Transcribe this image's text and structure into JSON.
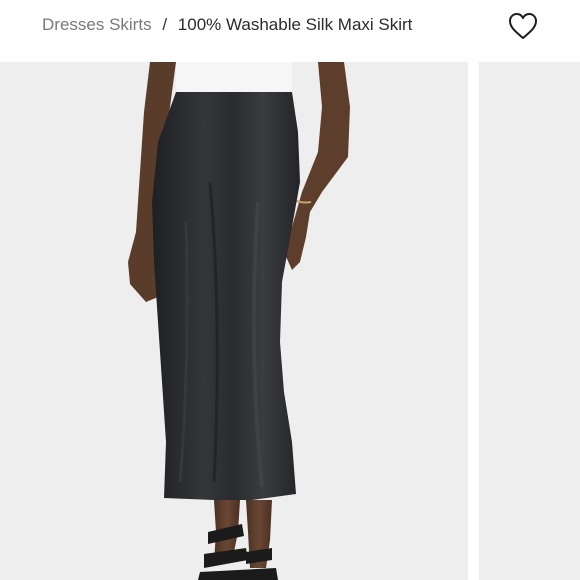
{
  "breadcrumb": {
    "items": [
      {
        "label": "Dresses Skirts",
        "link": true
      }
    ],
    "separator": "/",
    "current": "100% Washable Silk Maxi Skirt"
  },
  "icons": {
    "wishlist": "heart-outline-icon"
  },
  "gallery": {
    "current_image": "black silk maxi skirt product photo",
    "colors": {
      "background": "#eeeeee",
      "skirt": "#2c2d30",
      "top": "#f6f6f6",
      "skin": "#5a3c2b"
    }
  }
}
